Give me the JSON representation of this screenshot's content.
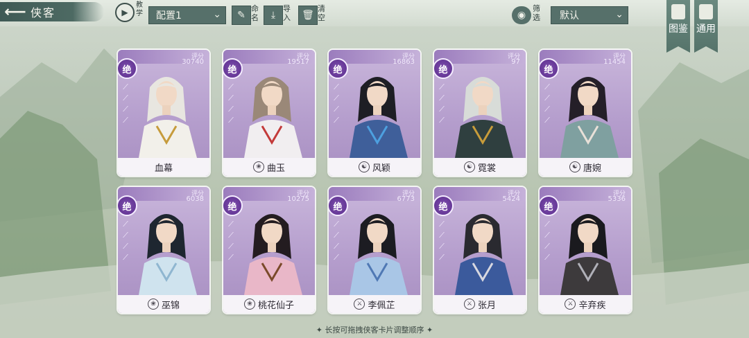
{
  "header": {
    "back_arrow": "⟵",
    "title": "侠客",
    "tutorial_label": "教学",
    "config_value": "配置1",
    "rename_label": "命名",
    "import_label": "导入",
    "clear_label": "清空",
    "filter_label": "筛选",
    "sort_value": "默认",
    "tujian_label": "图鉴",
    "tongyong_label": "通用"
  },
  "score_label": "评分",
  "rank_label": "绝",
  "cards": [
    {
      "name": "血幕",
      "score": "30740",
      "sect_icon": "none",
      "robe": "#f2f0ea",
      "hair": "#e8e6e0",
      "accent": "#c69b3c"
    },
    {
      "name": "曲玉",
      "score": "19517",
      "sect_icon": "lotus-icon",
      "robe": "#f1eef0",
      "hair": "#9a8878",
      "accent": "#c33a3a"
    },
    {
      "name": "风颖",
      "score": "16863",
      "sect_icon": "taiji-icon",
      "robe": "#3f5f9a",
      "hair": "#1e1e24",
      "accent": "#4da0e0"
    },
    {
      "name": "霓裳",
      "score": "97",
      "sect_icon": "taiji-icon",
      "robe": "#2f3f3f",
      "hair": "#d8dcd8",
      "accent": "#c89c3a"
    },
    {
      "name": "唐婉",
      "score": "11454",
      "sect_icon": "taiji-icon",
      "robe": "#7fa0a0",
      "hair": "#241f28",
      "accent": "#e8e0d8"
    },
    {
      "name": "巫锦",
      "score": "6038",
      "sect_icon": "lotus-icon",
      "robe": "#cfe3ee",
      "hair": "#1e2630",
      "accent": "#8fb6d0"
    },
    {
      "name": "桃花仙子",
      "score": "10275",
      "sect_icon": "lotus-icon",
      "robe": "#e9b7c8",
      "hair": "#231c20",
      "accent": "#7a4a2a"
    },
    {
      "name": "李佩芷",
      "score": "6773",
      "sect_icon": "sword-icon",
      "robe": "#a9c6e6",
      "hair": "#1c1c22",
      "accent": "#4f78b4"
    },
    {
      "name": "张月",
      "score": "5424",
      "sect_icon": "sword-icon",
      "robe": "#3b5a9c",
      "hair": "#2a2a30",
      "accent": "#d8d8e0"
    },
    {
      "name": "辛弃疾",
      "score": "5336",
      "sect_icon": "sword-icon",
      "robe": "#3d3a3c",
      "hair": "#1a1a1e",
      "accent": "#b0b0b8"
    }
  ],
  "footer_hint": "✦ 长按可拖拽侠客卡片调整顺序 ✦"
}
